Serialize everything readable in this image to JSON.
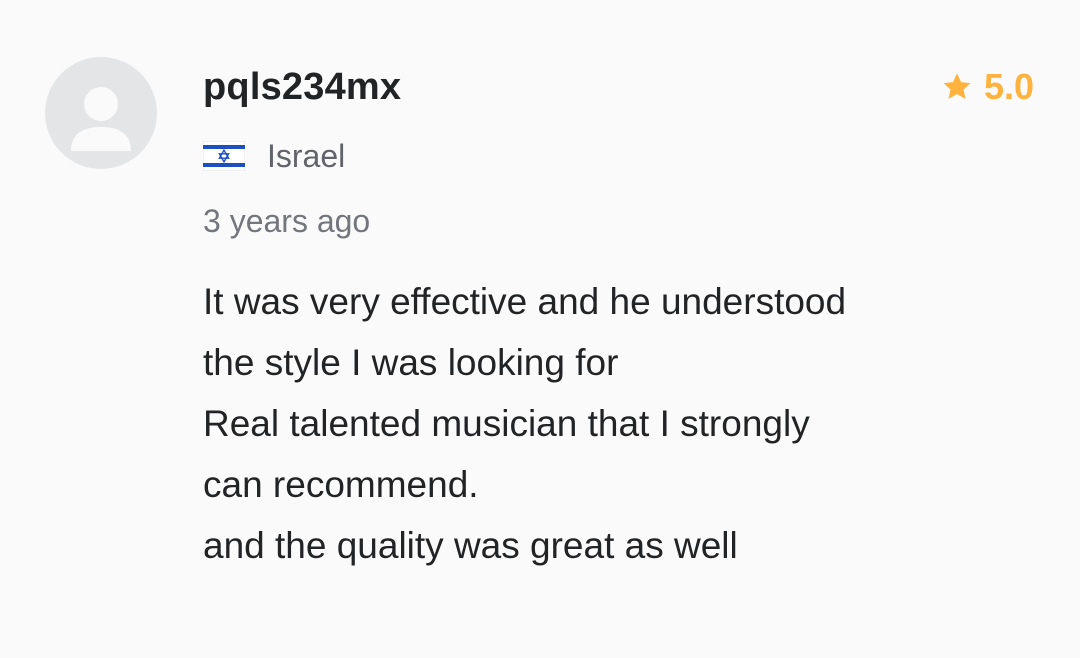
{
  "review": {
    "avatar_icon": "user-placeholder-icon",
    "username": "pqls234mx",
    "rating": {
      "icon": "star-icon",
      "value": "5.0",
      "color": "#ffb33e"
    },
    "country": {
      "flag_icon": "israel-flag-icon",
      "name": "Israel"
    },
    "time_ago": "3 years ago",
    "text_lines": [
      "It was very effective and he understood",
      "the style I was looking for",
      "Real talented musician that I strongly",
      "can recommend.",
      "and the quality was great as well"
    ]
  }
}
